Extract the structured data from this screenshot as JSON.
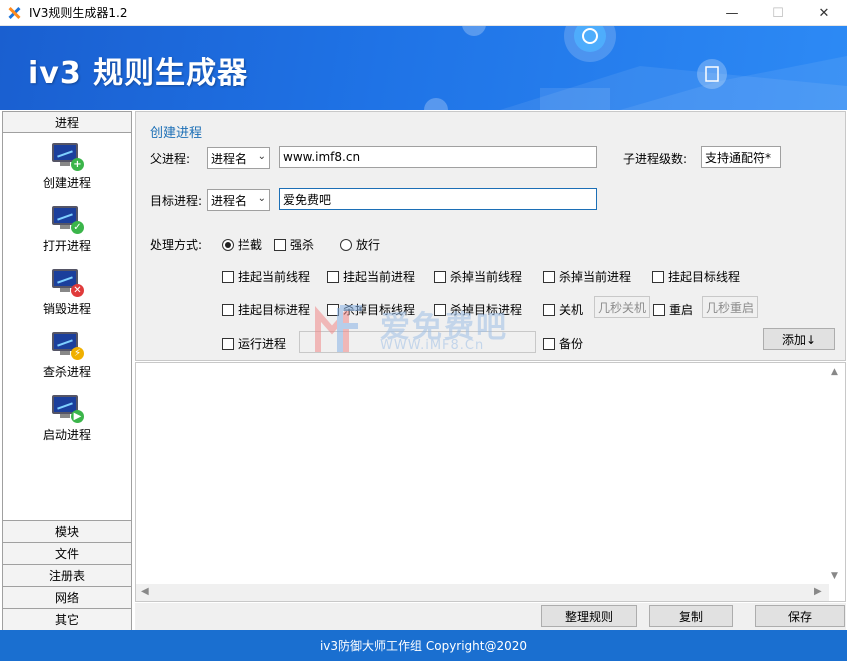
{
  "window": {
    "title": "IV3规则生成器1.2",
    "controls": {
      "minimize": "—",
      "maximize": "☐",
      "close": "✕"
    }
  },
  "banner": {
    "title": "iv3 规则生成器"
  },
  "sidebar": {
    "header": "进程",
    "items": [
      {
        "label": "创建进程",
        "icon": "monitor-add-icon",
        "badge": "+",
        "badge_color": "#3bb54a"
      },
      {
        "label": "打开进程",
        "icon": "monitor-check-icon",
        "badge": "✓",
        "badge_color": "#3bb54a"
      },
      {
        "label": "销毁进程",
        "icon": "monitor-delete-icon",
        "badge": "✕",
        "badge_color": "#e03b3b"
      },
      {
        "label": "查杀进程",
        "icon": "monitor-lightning-icon",
        "badge": "⚡",
        "badge_color": "#f0b000"
      },
      {
        "label": "启动进程",
        "icon": "monitor-play-icon",
        "badge": "▶",
        "badge_color": "#3bb54a"
      }
    ],
    "tabs": [
      "模块",
      "文件",
      "注册表",
      "网络",
      "其它"
    ]
  },
  "form": {
    "section_title": "创建进程",
    "parent_label": "父进程:",
    "parent_select": "进程名",
    "parent_value": "www.imf8.cn",
    "child_level_label": "子进程级数:",
    "child_level_value": "支持通配符*",
    "target_label": "目标进程:",
    "target_select": "进程名",
    "target_value": "爱免费吧",
    "handle_label": "处理方式:",
    "handle_options": [
      {
        "label": "拦截",
        "checked": true
      },
      {
        "label": "强杀",
        "type": "checkbox"
      },
      {
        "label": "放行",
        "checked": false
      }
    ],
    "checks_row1": [
      "挂起当前线程",
      "挂起当前进程",
      "杀掉当前线程",
      "杀掉当前进程",
      "挂起目标线程"
    ],
    "checks_row2": [
      "挂起目标进程",
      "杀掉目标线程",
      "杀掉目标进程",
      "关机",
      "重启"
    ],
    "shutdown_btn": "几秒关机",
    "restart_btn": "几秒重启",
    "run_process": "运行进程",
    "backup": "备份",
    "add_button": "添加↓"
  },
  "bottom_buttons": {
    "organize": "整理规则",
    "copy": "复制",
    "save": "保存"
  },
  "status": {
    "text": "iv3防御大师工作组 Copyright@2020"
  },
  "watermark": {
    "text1": "爱免费吧",
    "text2": "WWW.iMF8.Cn"
  },
  "colors": {
    "accent": "#1a6fd0",
    "section_title": "#1c6fb6"
  }
}
